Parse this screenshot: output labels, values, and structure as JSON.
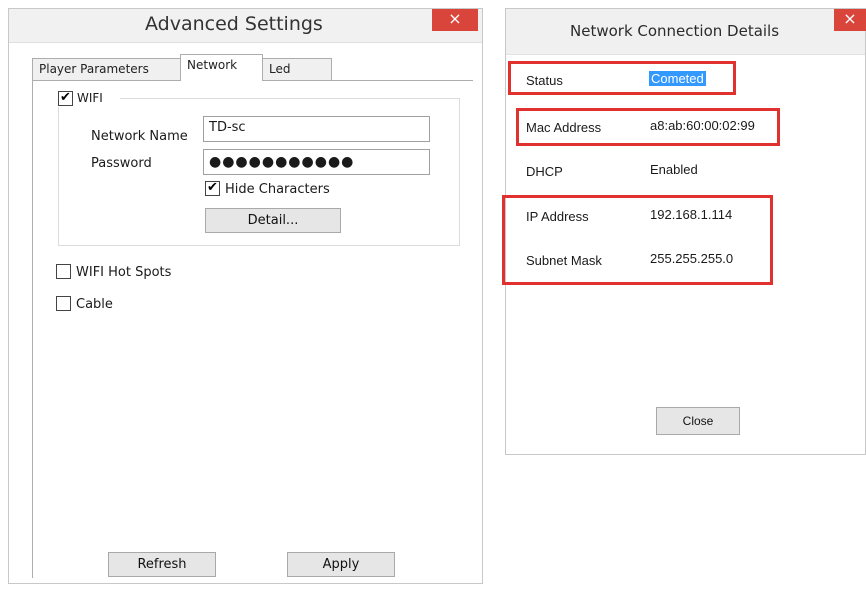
{
  "advanced": {
    "title": "Advanced Settings",
    "close_glyph": "×",
    "tabs": [
      {
        "label": "Player Parameters",
        "active": false
      },
      {
        "label": "Network",
        "active": true
      },
      {
        "label": "Led",
        "active": false
      }
    ],
    "wifi": {
      "label": "WIFI",
      "checked": true,
      "network_name_label": "Network Name",
      "network_name_value": "TD-sc",
      "password_label": "Password",
      "password_value": "●●●●●●●●●●●",
      "hide_characters_label": "Hide Characters",
      "hide_characters_checked": true,
      "detail_button": "Detail..."
    },
    "wifi_hotspots": {
      "label": "WIFI Hot Spots",
      "checked": false
    },
    "cable": {
      "label": "Cable",
      "checked": false
    },
    "refresh_button": "Refresh",
    "apply_button": "Apply",
    "check_glyph": "✔"
  },
  "details": {
    "title": "Network Connection Details",
    "close_glyph": "×",
    "rows": [
      {
        "label": "Status",
        "value": "Cometed"
      },
      {
        "label": "Mac Address",
        "value": "a8:ab:60:00:02:99"
      },
      {
        "label": "DHCP",
        "value": "Enabled"
      },
      {
        "label": "IP Address",
        "value": "192.168.1.114"
      },
      {
        "label": "Subnet Mask",
        "value": "255.255.255.0"
      }
    ],
    "close_button": "Close"
  },
  "colors": {
    "highlight_box": "#e0312f",
    "close_red": "#d9443b",
    "selection_blue": "#3399ff"
  }
}
